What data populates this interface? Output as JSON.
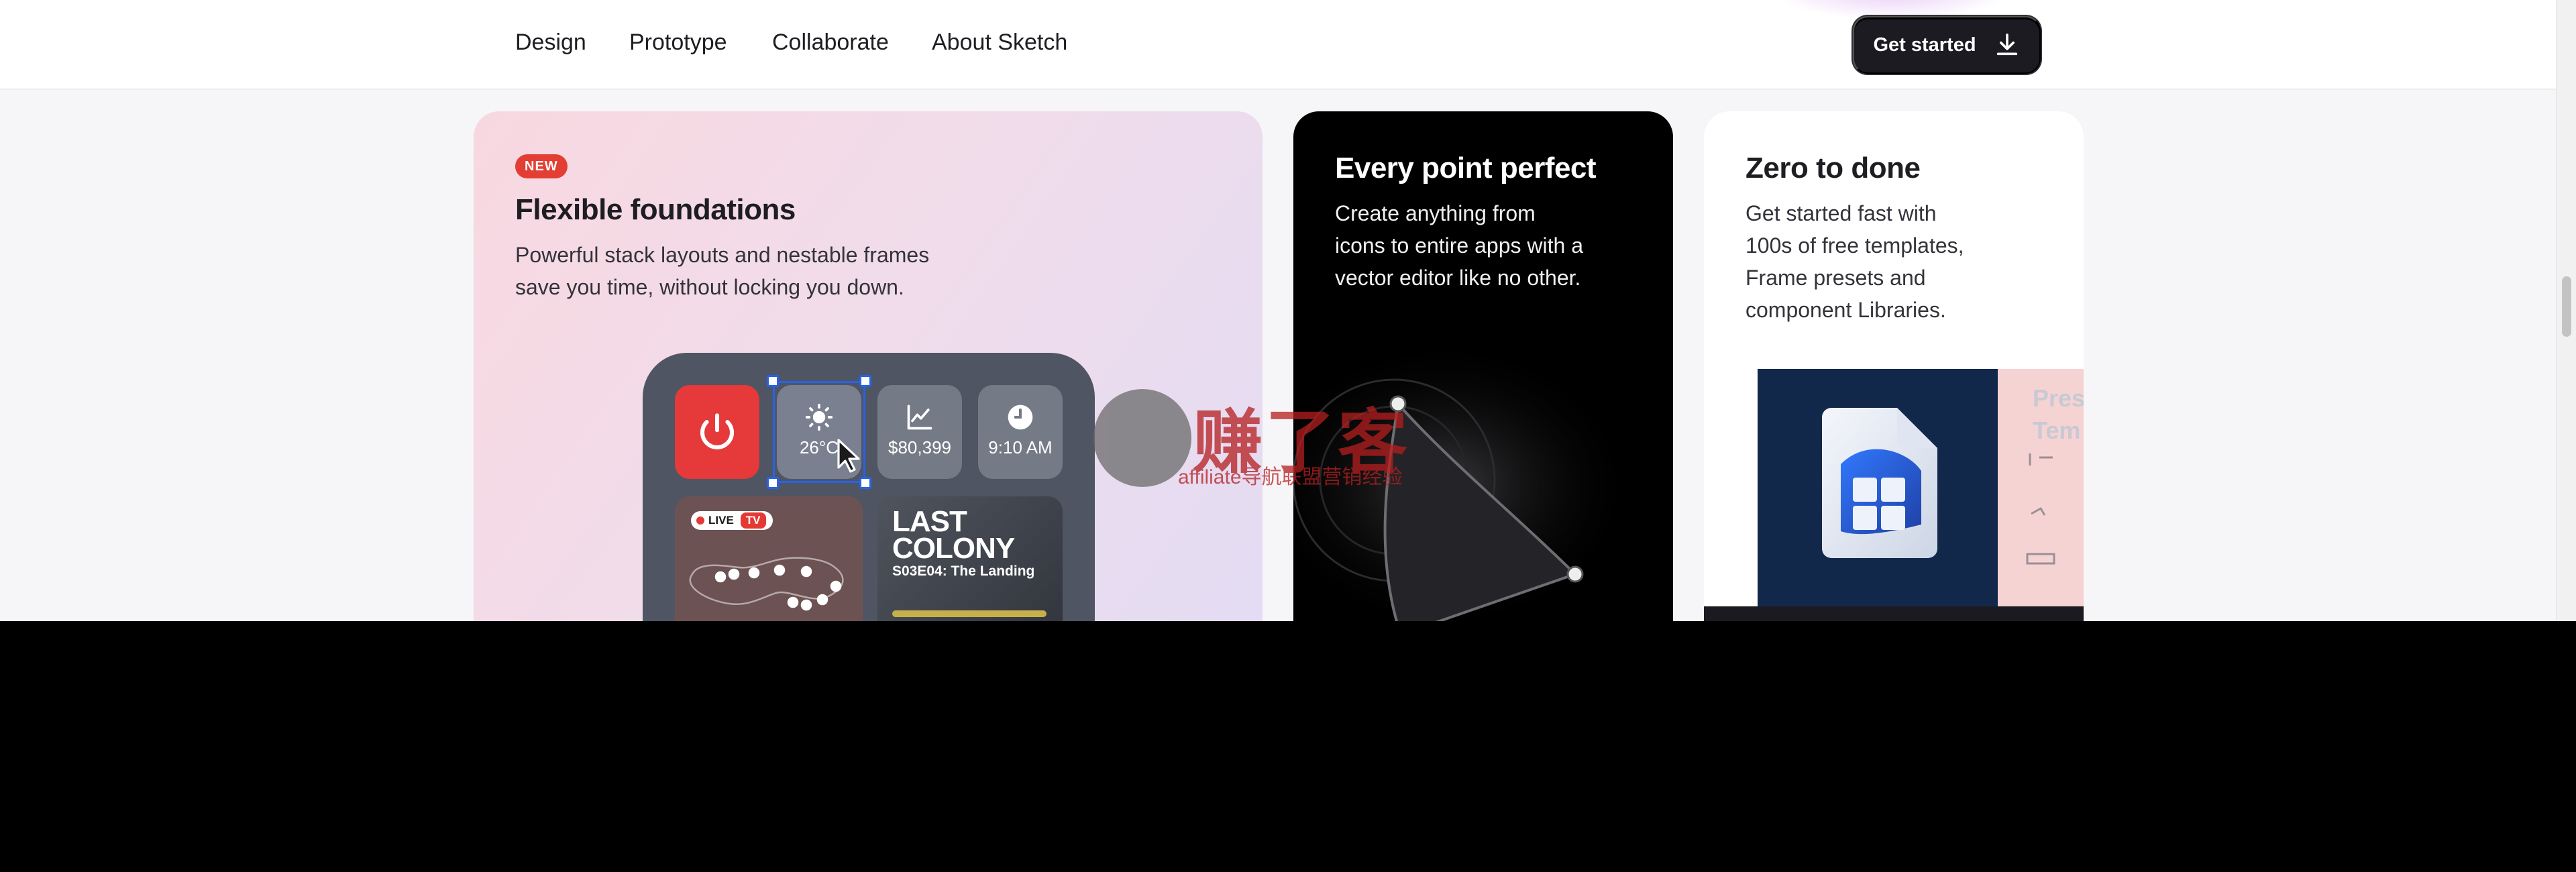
{
  "nav": {
    "items": [
      "Design",
      "Prototype",
      "Collaborate",
      "About Sketch"
    ],
    "cta_label": "Get started",
    "cta_icon": "download-icon"
  },
  "cards": [
    {
      "badge": "NEW",
      "title": "Flexible foundations",
      "desc_lines": [
        "Powerful stack layouts and nestable frames",
        "save you time, without locking you down."
      ]
    },
    {
      "title": "Every point perfect",
      "desc_lines": [
        "Create anything from",
        "icons to entire apps with a",
        "vector editor like no other."
      ]
    },
    {
      "title": "Zero to done",
      "desc_lines": [
        "Get started fast with",
        "100s of free templates,",
        "Frame presets and",
        "component Libraries."
      ],
      "preview_text": [
        "Pres",
        "Tem"
      ]
    }
  ],
  "widget": {
    "weather": "26°C",
    "stocks": "$80,399",
    "clock": "9:10 AM",
    "live_label": "LIVE",
    "tv_label": "TV",
    "show_title": "LAST COLONY",
    "show_episode": "S03E04: The Landing"
  },
  "watermark": {
    "title": "赚了客",
    "subtitle": "affiliate导航联盟营销经验"
  },
  "colors": {
    "accent_red": "#e23e33",
    "selection_blue": "#2563eb",
    "cta_bg": "#1b1b21"
  }
}
